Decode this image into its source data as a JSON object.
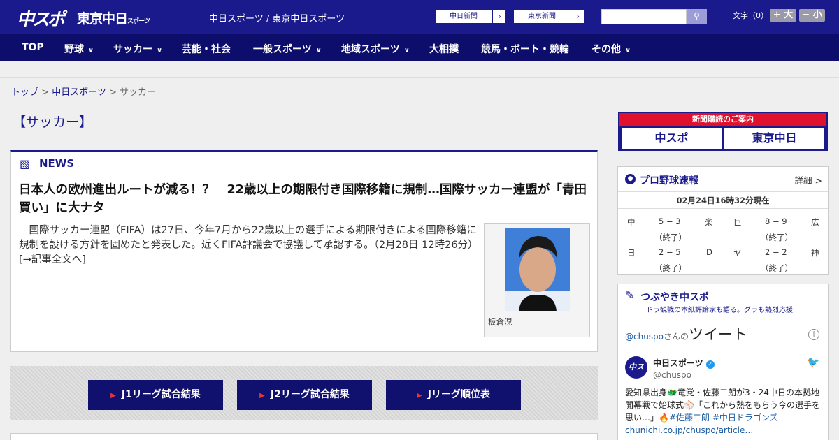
{
  "header": {
    "logo_chuspo": "中スポ",
    "logo_tokyo": "東京中日",
    "logo_tokyo_small": "スポーツ",
    "site_names": "中日スポーツ / 東京中日スポーツ",
    "paper_links": [
      {
        "label": "中日新聞"
      },
      {
        "label": "東京新聞"
      }
    ],
    "search": {
      "placeholder": "",
      "icon": "search-icon"
    },
    "font_size_label": "文字（0）",
    "font_bigger": "+ 大",
    "font_smaller": "− 小"
  },
  "nav": {
    "items": [
      {
        "label": "TOP"
      },
      {
        "label": "野球"
      },
      {
        "label": "サッカー"
      },
      {
        "label": "芸能・社会"
      },
      {
        "label": "一般スポーツ"
      },
      {
        "label": "地域スポーツ"
      },
      {
        "label": "大相撲"
      },
      {
        "label": "競馬・ボート・競輪"
      },
      {
        "label": "その他"
      }
    ]
  },
  "breadcrumb": {
    "top": "トップ",
    "sep": ">",
    "middle": "中日スポーツ",
    "current": "サッカー"
  },
  "page_title": "【サッカー】",
  "news": {
    "label": "NEWS",
    "headline": "日本人の欧州進出ルートが減る！？　22歳以上の期限付き国際移籍に規制…国際サッカー連盟が「青田買い」に大ナタ",
    "body": "　国際サッカー連盟（FIFA）は27日、今年7月から22歳以上の選手による期限付きによる国際移籍に規制を設ける方針を固めたと発表した。近くFIFA評議会で協議して承認する。（2月28日 12時26分）　[→記事全文へ]",
    "photo_caption": "板倉滉"
  },
  "jleague": [
    {
      "label": "J1リーグ試合結果"
    },
    {
      "label": "J2リーグ試合結果"
    },
    {
      "label": "Jリーグ順位表"
    }
  ],
  "subscription": {
    "title": "新聞購読のご案内",
    "chuspo": "中スポ",
    "tokyo": "東京中日"
  },
  "baseball": {
    "title": "プロ野球速報",
    "detail": "詳細 >",
    "time": "02月24日16時32分現在",
    "games": [
      {
        "home": "中",
        "score": "5 − 3",
        "away": "楽",
        "status": "（終了）"
      },
      {
        "home": "巨",
        "score": "8 − 9",
        "away": "広",
        "status": "（終了）"
      },
      {
        "home": "日",
        "score": "2 − 5",
        "away": "D",
        "status": "（終了）"
      },
      {
        "home": "ヤ",
        "score": "2 − 2",
        "away": "神",
        "status": "（終了）"
      }
    ]
  },
  "twitter_box": {
    "title": "つぶやき中スポ",
    "subtitle": "ドラ観戦の本紙評論家も語る。グラも熱烈応援",
    "handle_link": "@chuspo",
    "handle_suffix": "さんの",
    "tweets_label": "ツイート",
    "avatar": "中スポ",
    "account_name": "中日スポーツ",
    "account_handle": "@chuspo",
    "tweet_text": "愛知県出身🐲竜党・佐藤二朗が3・24中日の本拠地開幕戦で始球式⚾「これから熱をもらう今の選手を思い…」🔥",
    "hashtags": "#佐藤二朗 #中日ドラゴンズ",
    "link": "chunichi.co.jp/chuspo/article…"
  }
}
